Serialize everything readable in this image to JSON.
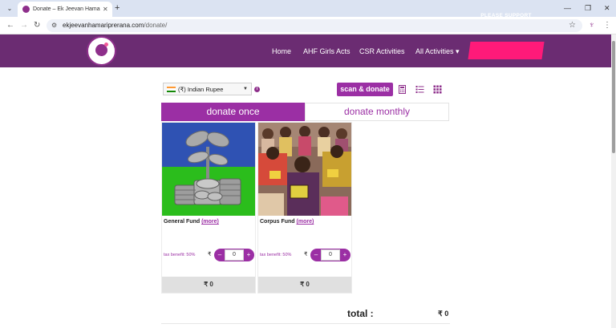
{
  "browser": {
    "tab_title": "Donate – Ek Jeevan Hamari Pre",
    "tab_close": "✕",
    "new_tab": "+",
    "url_host": "ekjeevanhamariprerana.com",
    "url_path": "/donate/",
    "window_minimize": "—",
    "window_maximize": "❐",
    "window_close": "✕"
  },
  "site": {
    "nav": [
      "Home",
      "AHF Girls Acts",
      "CSR Activities",
      "All Activities ▾"
    ],
    "support_label": "PLEASE SUPPORT",
    "colors": {
      "header": "#6b2c72",
      "accent": "#9b2fa4",
      "support": "#ff1a79"
    }
  },
  "controls": {
    "currency": "(₹) Indian Rupee",
    "info": "i",
    "scan_label": "scan & donate",
    "views": [
      "calculator-icon",
      "list-view-icon",
      "grid-view-icon"
    ]
  },
  "frequency": {
    "once": "donate once",
    "monthly": "donate monthly",
    "selected": "once"
  },
  "funds": [
    {
      "name": "General Fund",
      "more": "(more)",
      "tax": "tax benefit: 50%",
      "rupee": "₹",
      "minus": "–",
      "plus": "+",
      "amount": "0",
      "total": "₹ 0"
    },
    {
      "name": "Corpus Fund",
      "more": "(more)",
      "tax": "tax benefit: 50%",
      "rupee": "₹",
      "minus": "–",
      "plus": "+",
      "amount": "0",
      "total": "₹ 0"
    }
  ],
  "total": {
    "label": "total :",
    "amount": "₹ 0"
  }
}
